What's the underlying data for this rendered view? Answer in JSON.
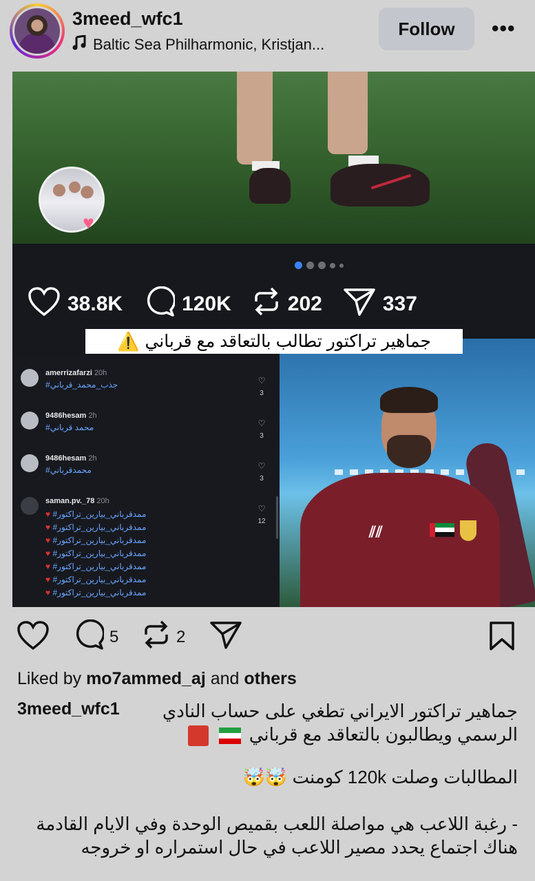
{
  "header": {
    "username": "3meed_wfc1",
    "audio": "Baltic Sea Philharmonic, Kristjan...",
    "follow_label": "Follow",
    "more_label": "•••"
  },
  "media": {
    "stats": {
      "likes": "38.8K",
      "comments": "120K",
      "reposts": "202",
      "shares": "337"
    },
    "banner": "جماهير تراكتور تطالب بالتعاقد مع قرباني",
    "comments": [
      {
        "user": "amerrizafarzi",
        "time": "20h",
        "text": "#جذب_محمد_قرباني",
        "likes": "3"
      },
      {
        "user": "9486hesam",
        "time": "2h",
        "text": "#محمد قرباني",
        "likes": "3"
      },
      {
        "user": "9486hesam",
        "time": "2h",
        "text": "#محمدقرباني",
        "likes": "3"
      },
      {
        "user": "saman.pv._78",
        "time": "20h",
        "text": "#ممدقرباني_بيارين_تراكتور",
        "likes": "12"
      }
    ]
  },
  "actions": {
    "comment_count": "5",
    "repost_count": "2"
  },
  "likes": {
    "prefix": "Liked by",
    "user": "mo7ammed_aj",
    "and": "and",
    "others": "others"
  },
  "caption": {
    "user": "3meed_wfc1",
    "line1": "جماهير تراكتور الايراني تطغي على حساب النادي",
    "line2": "الرسمي ويطالبون بالتعاقد مع قرباني",
    "line3": "المطالبات وصلت 120k كومنت",
    "line4": "- رغبة اللاعب هي مواصلة اللعب بقميص الوحدة وفي الايام القادمة",
    "line5": "هناك اجتماع يحدد مصير اللاعب في حال استمراره او خروجه"
  }
}
